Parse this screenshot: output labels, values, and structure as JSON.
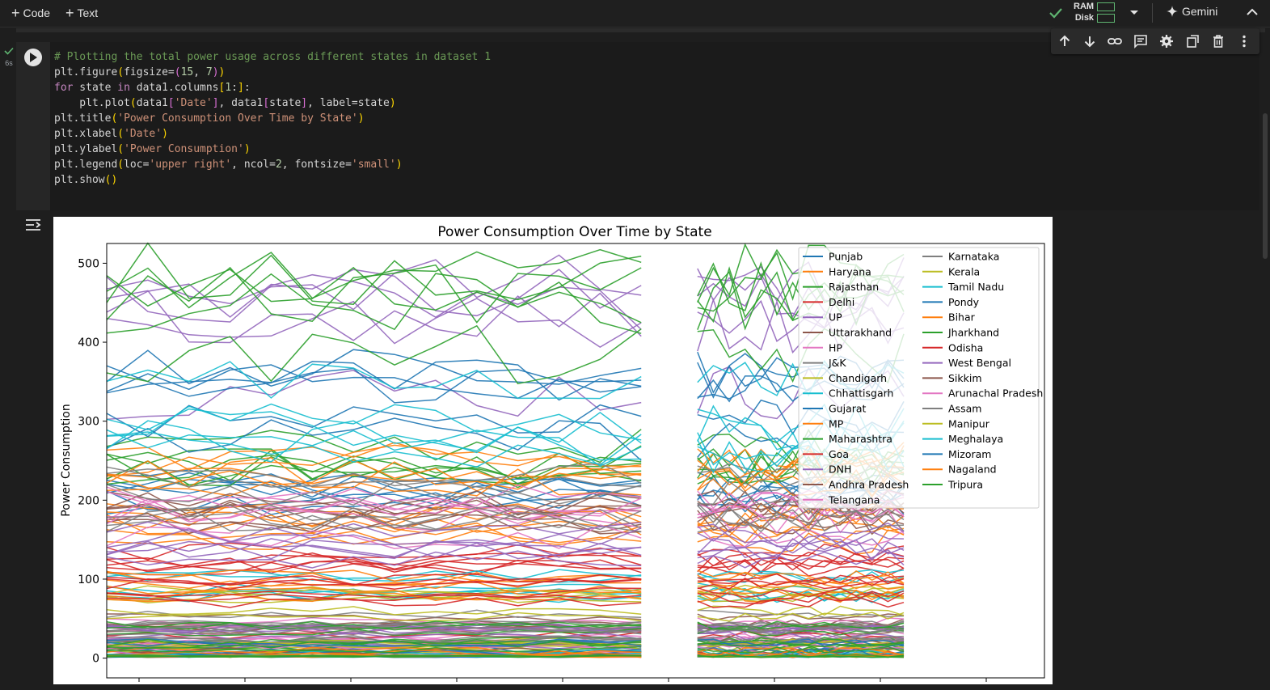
{
  "toolbar": {
    "code_label": "Code",
    "text_label": "Text",
    "ram_label": "RAM",
    "disk_label": "Disk",
    "gemini_label": "Gemini"
  },
  "cell": {
    "exec_time": "6s",
    "code_lines": [
      "# Plotting the total power usage across different states in dataset 1",
      "plt.figure(figsize=(15, 7))",
      "for state in data1.columns[1:]:",
      "    plt.plot(data1['Date'], data1[state], label=state)",
      "plt.title('Power Consumption Over Time by State')",
      "plt.xlabel('Date')",
      "plt.ylabel('Power Consumption')",
      "plt.legend(loc='upper right', ncol=2, fontsize='small')",
      "plt.show()"
    ]
  },
  "chart_data": {
    "type": "line",
    "title": "Power Consumption Over Time by State",
    "xlabel": "",
    "ylabel": "Power Consumption",
    "ylim": [
      -25,
      525
    ],
    "yticks": [
      0,
      100,
      200,
      300,
      400,
      500
    ],
    "x_tick_count": 9,
    "x_tick_labels_visible": false,
    "grid": false,
    "legend": {
      "location": "upper right",
      "ncol": 2
    },
    "segments": [
      {
        "name": "first period",
        "x_range": [
          0,
          0.57
        ]
      },
      {
        "name": "second period",
        "x_range": [
          0.63,
          0.85
        ]
      }
    ],
    "series": [
      {
        "name": "Punjab",
        "color": "#1f77b4",
        "base": 205
      },
      {
        "name": "Haryana",
        "color": "#ff7f0e",
        "base": 175
      },
      {
        "name": "Rajasthan",
        "color": "#2ca02c",
        "base": 250
      },
      {
        "name": "Delhi",
        "color": "#d62728",
        "base": 120
      },
      {
        "name": "UP",
        "color": "#9467bd",
        "base": 410
      },
      {
        "name": "Uttarakhand",
        "color": "#8c564b",
        "base": 40
      },
      {
        "name": "HP",
        "color": "#e377c2",
        "base": 30
      },
      {
        "name": "J&K",
        "color": "#7f7f7f",
        "base": 45
      },
      {
        "name": "Chandigarh",
        "color": "#bcbd22",
        "base": 5
      },
      {
        "name": "Chhattisgarh",
        "color": "#17becf",
        "base": 85
      },
      {
        "name": "Gujarat",
        "color": "#1f77b4",
        "base": 310
      },
      {
        "name": "MP",
        "color": "#ff7f0e",
        "base": 230
      },
      {
        "name": "Maharashtra",
        "color": "#2ca02c",
        "base": 440
      },
      {
        "name": "Goa",
        "color": "#d62728",
        "base": 10
      },
      {
        "name": "DNH",
        "color": "#9467bd",
        "base": 20
      },
      {
        "name": "Andhra Pradesh",
        "color": "#8c564b",
        "base": 170
      },
      {
        "name": "Telangana",
        "color": "#e377c2",
        "base": 180
      },
      {
        "name": "Karnataka",
        "color": "#7f7f7f",
        "base": 200
      },
      {
        "name": "Kerala",
        "color": "#bcbd22",
        "base": 70
      },
      {
        "name": "Tamil Nadu",
        "color": "#17becf",
        "base": 310
      },
      {
        "name": "Pondy",
        "color": "#1f77b4",
        "base": 8
      },
      {
        "name": "Bihar",
        "color": "#ff7f0e",
        "base": 95
      },
      {
        "name": "Jharkhand",
        "color": "#2ca02c",
        "base": 25
      },
      {
        "name": "Odisha",
        "color": "#d62728",
        "base": 80
      },
      {
        "name": "West Bengal",
        "color": "#9467bd",
        "base": 150
      },
      {
        "name": "Sikkim",
        "color": "#8c564b",
        "base": 2
      },
      {
        "name": "Arunachal Pradesh",
        "color": "#e377c2",
        "base": 3
      },
      {
        "name": "Assam",
        "color": "#7f7f7f",
        "base": 30
      },
      {
        "name": "Manipur",
        "color": "#bcbd22",
        "base": 3
      },
      {
        "name": "Meghalaya",
        "color": "#17becf",
        "base": 6
      },
      {
        "name": "Mizoram",
        "color": "#1f77b4",
        "base": 2
      },
      {
        "name": "Nagaland",
        "color": "#ff7f0e",
        "base": 2
      },
      {
        "name": "Tripura",
        "color": "#2ca02c",
        "base": 4
      }
    ]
  }
}
